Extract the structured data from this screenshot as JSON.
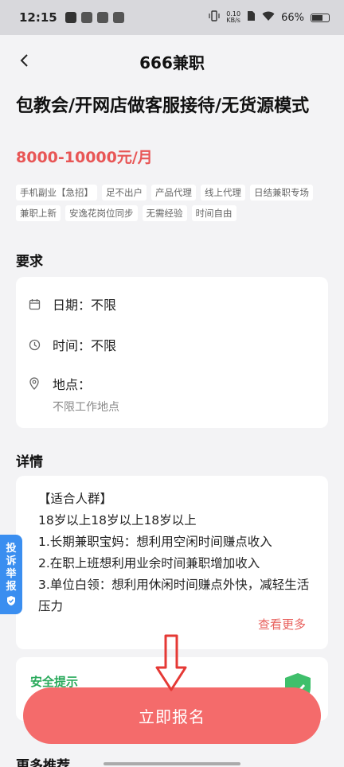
{
  "status_bar": {
    "time": "12:15",
    "speed_value": "0.10",
    "speed_unit": "KB/s",
    "battery": "66%"
  },
  "nav": {
    "title": "666兼职"
  },
  "job": {
    "title": "包教会/开网店做客服接待/无货源模式",
    "salary": "8000-10000元/月",
    "tags": [
      "手机副业【急招】",
      "足不出户",
      "产品代理",
      "线上代理",
      "日结兼职专场",
      "兼职上新",
      "安逸花岗位同步",
      "无需经验",
      "时间自由"
    ]
  },
  "requirements": {
    "label": "要求",
    "date": "日期：不限",
    "time": "时间：不限",
    "location_label": "地点：",
    "location_value": "不限工作地点"
  },
  "details": {
    "label": "详情",
    "lines": [
      "【适合人群】",
      "18岁以上18岁以上18岁以上",
      "1.长期兼职宝妈：想利用空闲时间赚点收入",
      "2.在职上班想利用业余时间兼职增加收入",
      "3.单位白领：想利用休闲时间赚点外快，减轻生活压力"
    ],
    "see_more": "查看更多"
  },
  "safety": {
    "title": "安全提示"
  },
  "apply": {
    "label": "立即报名"
  },
  "more": {
    "label": "更多推荐"
  },
  "report_tab": {
    "chars": [
      "投",
      "诉",
      "举",
      "报"
    ]
  },
  "colors": {
    "accent": "#f46b6b",
    "salary": "#e85656",
    "safety_green": "#2aaa5c",
    "report_blue": "#3a8ef0"
  }
}
